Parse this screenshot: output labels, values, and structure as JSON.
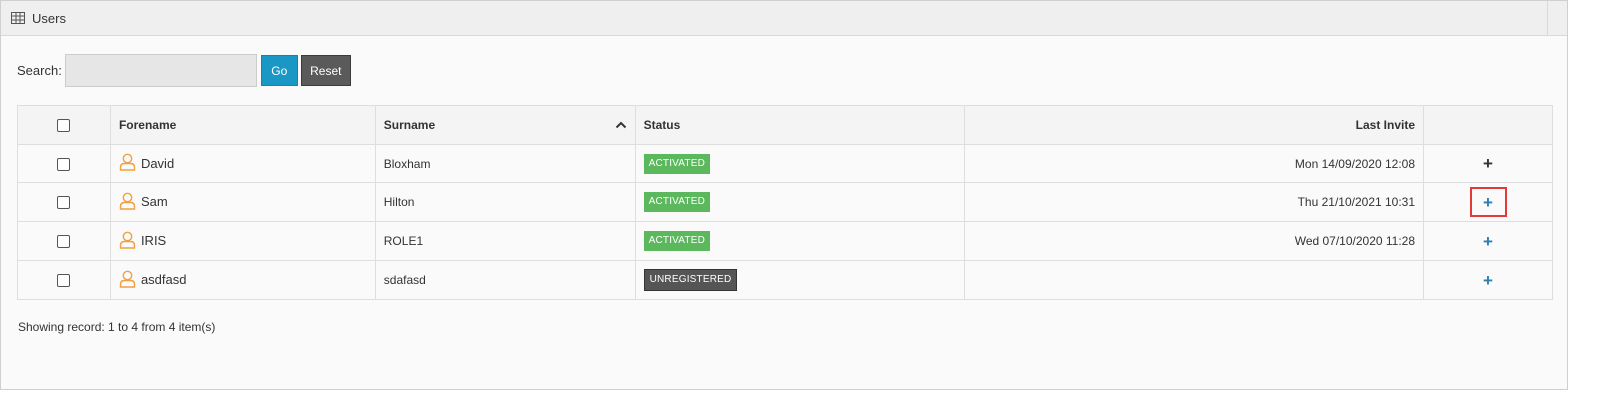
{
  "panel": {
    "title": "Users",
    "icon": "table-grid-icon"
  },
  "search": {
    "label": "Search:",
    "value": "",
    "placeholder": "",
    "go_label": "Go",
    "reset_label": "Reset"
  },
  "table": {
    "headers": {
      "forename": "Forename",
      "surname": "Surname",
      "status": "Status",
      "last_invite": "Last Invite"
    },
    "sort": {
      "column": "Surname",
      "direction": "ascending",
      "icon": "chevron-up-icon"
    },
    "rows": [
      {
        "forename": "David",
        "surname": "Bloxham",
        "status": "ACTIVATED",
        "last_invite": "Mon 14/09/2020 12:08",
        "action": "+"
      },
      {
        "forename": "Sam",
        "surname": "Hilton",
        "status": "ACTIVATED",
        "last_invite": "Thu 21/10/2021 10:31",
        "action": "+"
      },
      {
        "forename": "IRIS",
        "surname": "ROLE1",
        "status": "ACTIVATED",
        "last_invite": "Wed 07/10/2020 11:28",
        "action": "+"
      },
      {
        "forename": "asdfasd",
        "surname": "sdafasd",
        "status": "UNREGISTERED",
        "last_invite": "",
        "action": "+"
      }
    ]
  },
  "footer": {
    "record_text": "Showing record: 1 to 4 from 4 item(s)"
  },
  "colors": {
    "go_button": "#1a97c4",
    "reset_button": "#5a5a5a",
    "activated_badge": "#5cb85c",
    "unregistered_badge": "#555555",
    "user_icon": "#f0a040",
    "plus_action": "#2a7fb0",
    "highlight_border": "#e03a3a"
  }
}
